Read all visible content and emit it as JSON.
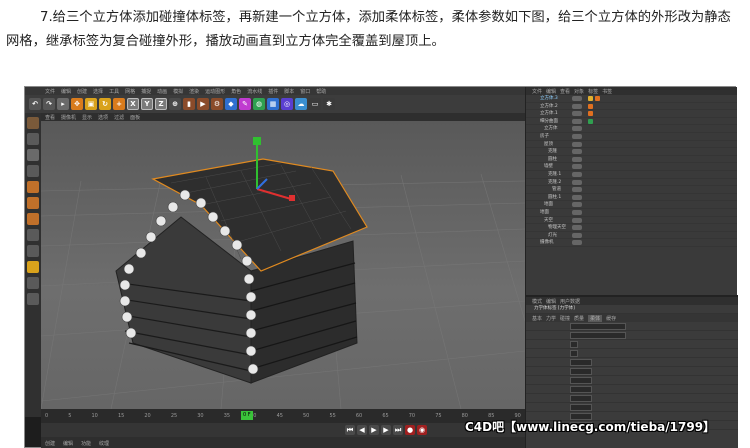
{
  "caption": "7.给三个立方体添加碰撞体标签，再新建一个立方体，添加柔体标签，柔体参数如下图，给三个立方体的外形改为静态网格，继承标签为复合碰撞外形，播放动画直到立方体完全覆盖到屋顶上。",
  "toolbar": {
    "axis_x": "X",
    "axis_y": "Y",
    "axis_z": "Z"
  },
  "timeline": {
    "ticks": [
      "0",
      "5",
      "10",
      "15",
      "20",
      "25",
      "30",
      "35",
      "40",
      "45",
      "50",
      "55",
      "60",
      "65",
      "70",
      "75",
      "80",
      "85",
      "90"
    ],
    "current_frame": "0 F"
  },
  "watermark": "C4D吧【www.linecg.com/tieba/1799】",
  "colors": {
    "viewport_bg": "#5f5f5f",
    "selection": "#f0a020",
    "axis_x": "#e03030",
    "axis_y": "#30c030",
    "axis_z": "#3070e0"
  }
}
